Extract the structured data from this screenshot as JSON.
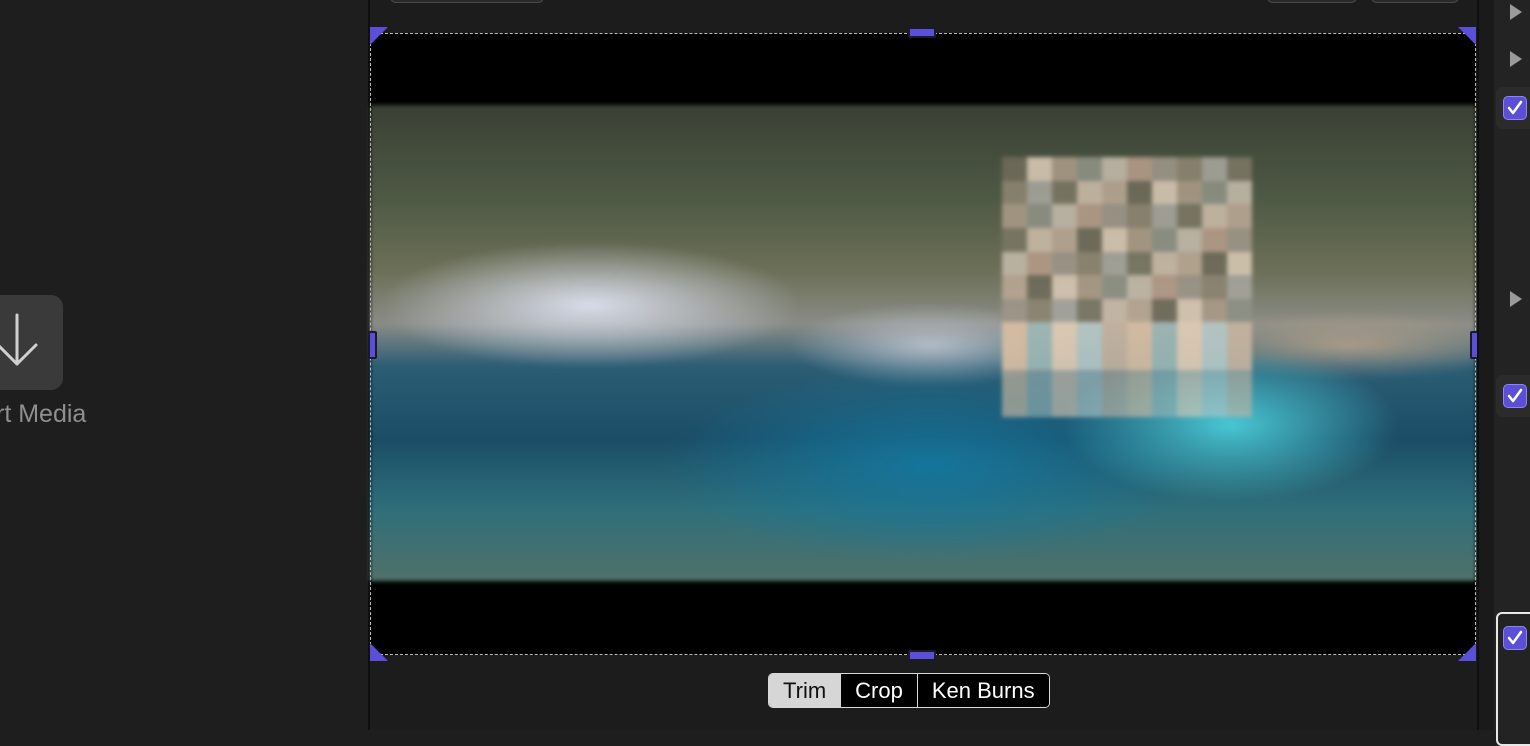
{
  "media_browser": {
    "import_label": "rt Media",
    "import_icon": "download-arrow-icon"
  },
  "viewer": {
    "modes": [
      {
        "label": "Trim",
        "active": true
      },
      {
        "label": "Crop",
        "active": false
      },
      {
        "label": "Ken Burns",
        "active": false
      }
    ],
    "accent_color": "#5a4fd6"
  },
  "inspector": {
    "rows": [
      {
        "type": "disclosure",
        "icon": "disclosure-triangle-icon"
      },
      {
        "type": "disclosure",
        "icon": "disclosure-triangle-icon"
      },
      {
        "type": "checkbox",
        "checked": true
      },
      {
        "type": "disclosure",
        "icon": "disclosure-triangle-icon"
      },
      {
        "type": "checkbox",
        "checked": true
      },
      {
        "type": "checkbox",
        "checked": true
      }
    ]
  }
}
